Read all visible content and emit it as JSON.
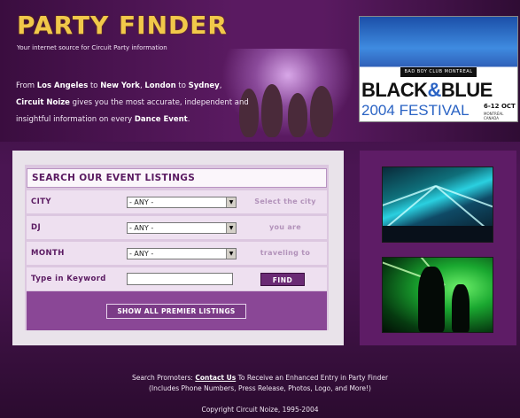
{
  "header": {
    "logo_text": "PARTY FINDER",
    "tagline": "Your internet source for Circuit Party information",
    "intro": {
      "p1": "From ",
      "city1": "Los Angeles",
      "p2": " to ",
      "city2": "New York",
      "p3": ", ",
      "city3": "London",
      "p4": " to ",
      "city4": "Sydney",
      "p5": ",",
      "brand": "Circuit Noize",
      "p6": " gives you the most accurate, independent and insightful information on every ",
      "event": "Dance Event",
      "p7": "."
    }
  },
  "banner": {
    "club": "BAD BOY CLUB MONTREAL",
    "title_part1": "BLACK",
    "amp": "&",
    "title_part2": "BLUE",
    "year": "2004",
    "festival": "FESTIVAL",
    "dates": "6-12 OCT",
    "location": "MONTRÉAL CANADA"
  },
  "search": {
    "title": "SEARCH OUR EVENT LISTINGS",
    "city_label": "CITY",
    "dj_label": "DJ",
    "month_label": "MONTH",
    "keyword_label": "Type in Keyword",
    "city_value": "- ANY -",
    "dj_value": "- ANY -",
    "month_value": "- ANY -",
    "hint_city": "Select the city",
    "hint_dj": "you are",
    "hint_month": "traveling to",
    "find_label": "FIND",
    "show_all_label": "SHOW ALL PREMIER LISTINGS"
  },
  "footer": {
    "line1_prefix": "Search Promoters: ",
    "contact_link": "Contact Us",
    "line1_suffix": " To Receive an Enhanced Entry in Party Finder",
    "line2": "(Includes Phone Numbers, Press Release, Photos, Logo, and More!)",
    "copyright": "Copyright Circuit Noize, 1995-2004"
  },
  "colors": {
    "accent_purple": "#5a1a61",
    "logo_gold": "#f1c84a",
    "panel_light": "#eee0f0"
  }
}
